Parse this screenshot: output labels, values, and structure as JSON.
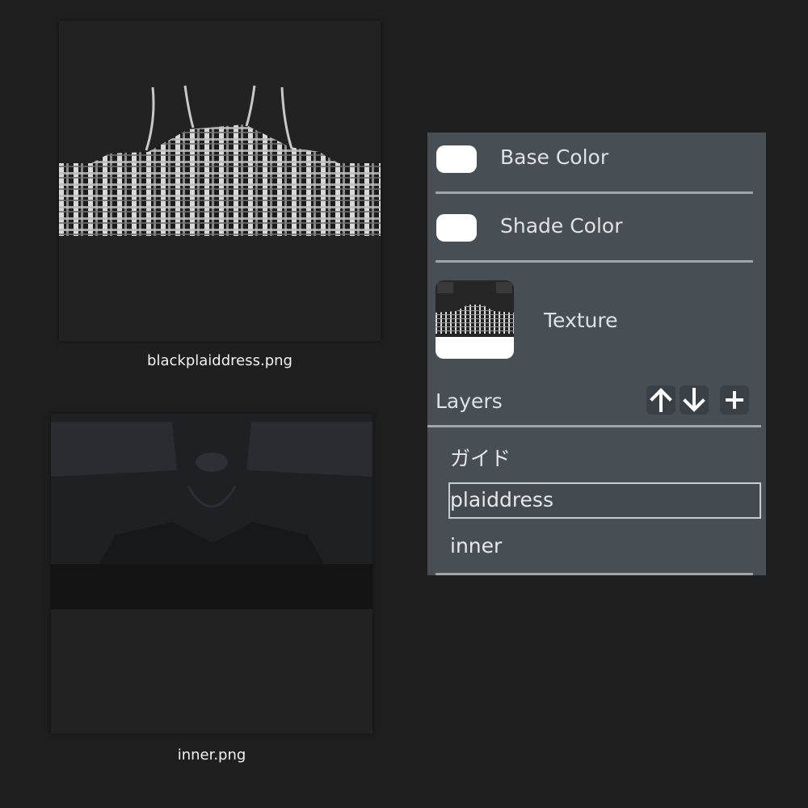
{
  "files": [
    {
      "name": "blackplaiddress.png"
    },
    {
      "name": "inner.png"
    }
  ],
  "panel": {
    "base_color": {
      "label": "Base Color",
      "value": "#ffffff"
    },
    "shade_color": {
      "label": "Shade Color",
      "value": "#ffffff"
    },
    "texture": {
      "label": "Texture"
    },
    "layers": {
      "title": "Layers",
      "buttons": [
        "arrow-up-icon",
        "arrow-down-icon",
        "plus-icon"
      ],
      "items": [
        {
          "label": "ガイド",
          "selected": false
        },
        {
          "label": "plaiddress",
          "selected": true
        },
        {
          "label": "inner",
          "selected": false
        }
      ]
    }
  },
  "colors": {
    "background": "#1f1f1f",
    "panel": "#474e54",
    "divider": "#a3a6a8"
  }
}
